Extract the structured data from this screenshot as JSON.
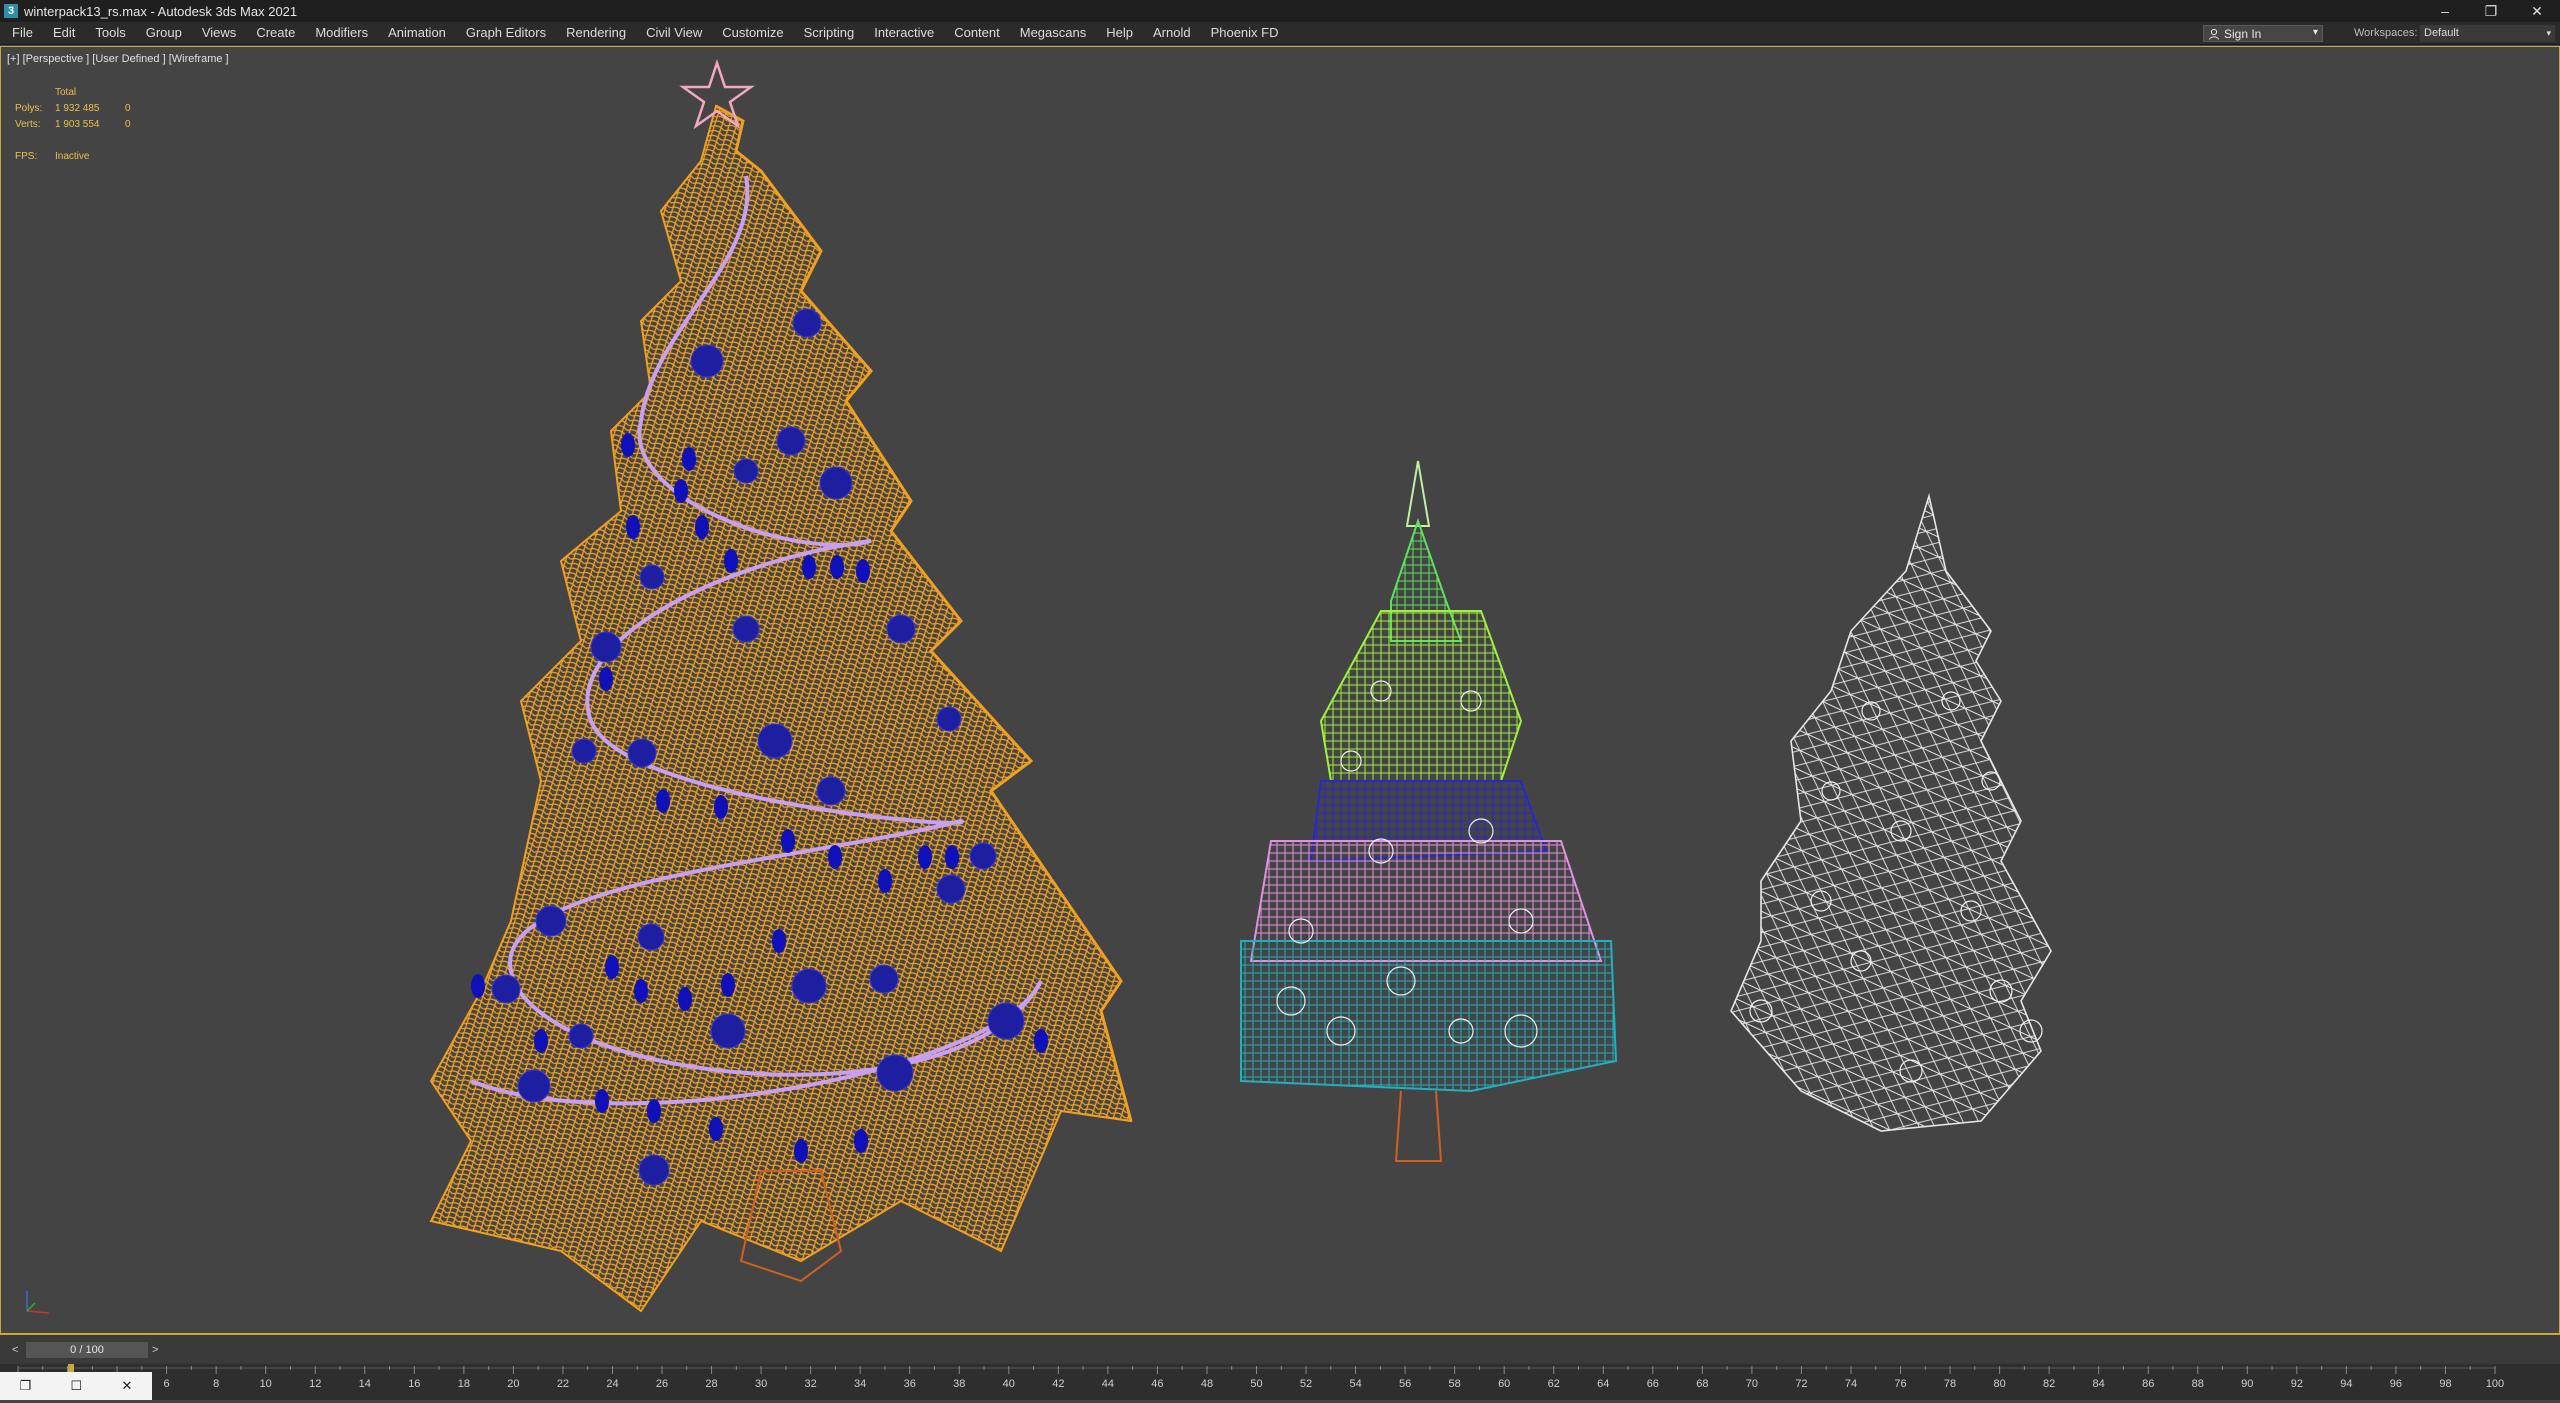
{
  "window": {
    "title": "winterpack13_rs.max - Autodesk 3ds Max 2021",
    "app_icon": "3",
    "controls": {
      "minimize": "–",
      "restore": "❐",
      "close": "✕"
    }
  },
  "menu": [
    "File",
    "Edit",
    "Tools",
    "Group",
    "Views",
    "Create",
    "Modifiers",
    "Animation",
    "Graph Editors",
    "Rendering",
    "Civil View",
    "Customize",
    "Scripting",
    "Interactive",
    "Content",
    "Megascans",
    "Help",
    "Arnold",
    "Phoenix FD"
  ],
  "signin": {
    "label": "Sign In",
    "dropdown": "▾"
  },
  "workspaces": {
    "label": "Workspaces:",
    "value": "Default",
    "dropdown": "▾"
  },
  "viewport": {
    "label": "[+] [Perspective ] [User Defined ] [Wireframe ]",
    "stats": {
      "header": "Total",
      "polys_label": "Polys:",
      "polys_value": "1 932 485",
      "polys_sel": "0",
      "verts_label": "Verts:",
      "verts_value": "1 903 554",
      "verts_sel": "0",
      "fps_label": "FPS:",
      "fps_value": "Inactive"
    },
    "colors": {
      "tree1": "#f0a020",
      "tree1_ornaments": "#1e1ea0",
      "tree1_garland": "#c9a0f0",
      "tree2_top": "#5de05d",
      "tree2_mid": "#a0f040",
      "tree2_blue": "#2828c8",
      "tree2_pink": "#e090e0",
      "tree2_cyan": "#20b0c0",
      "tree3": "#e6e6e6",
      "border": "#c8a83c"
    }
  },
  "timeslider": {
    "prev": "<",
    "frame": "0 / 100",
    "next": ">"
  },
  "trackbar": {
    "start": 0,
    "end": 100,
    "step": 2,
    "current": 0
  },
  "taskbar": {
    "icons": [
      "❐",
      "☐",
      "✕"
    ]
  }
}
